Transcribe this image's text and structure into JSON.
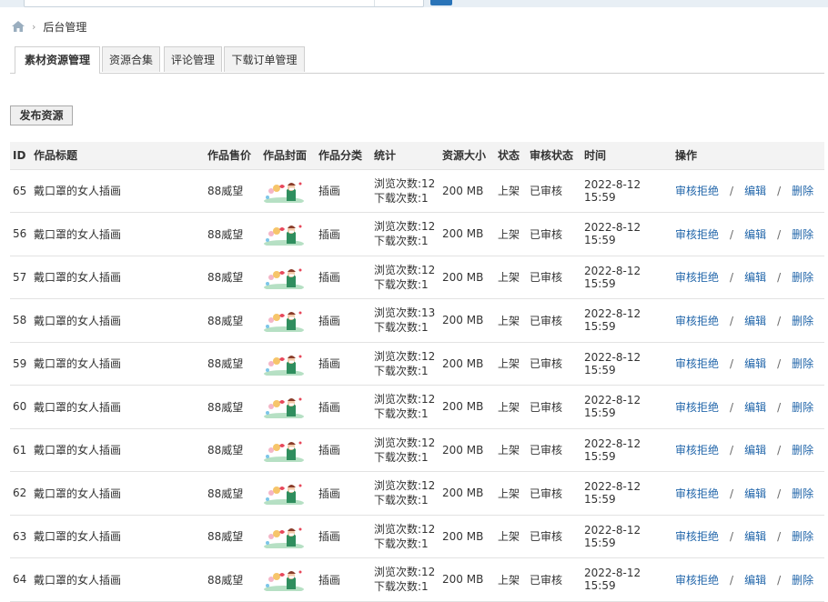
{
  "breadcrumb": {
    "home_icon": "home-icon",
    "separator": "›",
    "current": "后台管理"
  },
  "tabs": [
    {
      "label": "素材资源管理",
      "active": true
    },
    {
      "label": "资源合集",
      "active": false
    },
    {
      "label": "评论管理",
      "active": false
    },
    {
      "label": "下载订单管理",
      "active": false
    }
  ],
  "publish_button": "发布资源",
  "table": {
    "headers": {
      "id": "ID",
      "title": "作品标题",
      "price": "作品售价",
      "cover": "作品封面",
      "category": "作品分类",
      "stats": "统计",
      "size": "资源大小",
      "status": "状态",
      "review": "审核状态",
      "time": "时间",
      "actions": "操作"
    },
    "rows": [
      {
        "id": "65",
        "title": "戴口罩的女人插画",
        "price": "88威望",
        "category": "插画",
        "views": "浏览次数:12",
        "downloads": "下载次数:1",
        "size": "200 MB",
        "status": "上架",
        "review": "已审核",
        "time": "2022-8-12 15:59",
        "reject": "审核拒绝",
        "edit": "编辑",
        "delete": "删除"
      },
      {
        "id": "56",
        "title": "戴口罩的女人插画",
        "price": "88威望",
        "category": "插画",
        "views": "浏览次数:12",
        "downloads": "下载次数:1",
        "size": "200 MB",
        "status": "上架",
        "review": "已审核",
        "time": "2022-8-12 15:59",
        "reject": "审核拒绝",
        "edit": "编辑",
        "delete": "删除"
      },
      {
        "id": "57",
        "title": "戴口罩的女人插画",
        "price": "88威望",
        "category": "插画",
        "views": "浏览次数:12",
        "downloads": "下载次数:1",
        "size": "200 MB",
        "status": "上架",
        "review": "已审核",
        "time": "2022-8-12 15:59",
        "reject": "审核拒绝",
        "edit": "编辑",
        "delete": "删除"
      },
      {
        "id": "58",
        "title": "戴口罩的女人插画",
        "price": "88威望",
        "category": "插画",
        "views": "浏览次数:13",
        "downloads": "下载次数:1",
        "size": "200 MB",
        "status": "上架",
        "review": "已审核",
        "time": "2022-8-12 15:59",
        "reject": "审核拒绝",
        "edit": "编辑",
        "delete": "删除"
      },
      {
        "id": "59",
        "title": "戴口罩的女人插画",
        "price": "88威望",
        "category": "插画",
        "views": "浏览次数:12",
        "downloads": "下载次数:1",
        "size": "200 MB",
        "status": "上架",
        "review": "已审核",
        "time": "2022-8-12 15:59",
        "reject": "审核拒绝",
        "edit": "编辑",
        "delete": "删除"
      },
      {
        "id": "60",
        "title": "戴口罩的女人插画",
        "price": "88威望",
        "category": "插画",
        "views": "浏览次数:12",
        "downloads": "下载次数:1",
        "size": "200 MB",
        "status": "上架",
        "review": "已审核",
        "time": "2022-8-12 15:59",
        "reject": "审核拒绝",
        "edit": "编辑",
        "delete": "删除"
      },
      {
        "id": "61",
        "title": "戴口罩的女人插画",
        "price": "88威望",
        "category": "插画",
        "views": "浏览次数:12",
        "downloads": "下载次数:1",
        "size": "200 MB",
        "status": "上架",
        "review": "已审核",
        "time": "2022-8-12 15:59",
        "reject": "审核拒绝",
        "edit": "编辑",
        "delete": "删除"
      },
      {
        "id": "62",
        "title": "戴口罩的女人插画",
        "price": "88威望",
        "category": "插画",
        "views": "浏览次数:12",
        "downloads": "下载次数:1",
        "size": "200 MB",
        "status": "上架",
        "review": "已审核",
        "time": "2022-8-12 15:59",
        "reject": "审核拒绝",
        "edit": "编辑",
        "delete": "删除"
      },
      {
        "id": "63",
        "title": "戴口罩的女人插画",
        "price": "88威望",
        "category": "插画",
        "views": "浏览次数:12",
        "downloads": "下载次数:1",
        "size": "200 MB",
        "status": "上架",
        "review": "已审核",
        "time": "2022-8-12 15:59",
        "reject": "审核拒绝",
        "edit": "编辑",
        "delete": "删除"
      },
      {
        "id": "64",
        "title": "戴口罩的女人插画",
        "price": "88威望",
        "category": "插画",
        "views": "浏览次数:12",
        "downloads": "下载次数:1",
        "size": "200 MB",
        "status": "上架",
        "review": "已审核",
        "time": "2022-8-12 15:59",
        "reject": "审核拒绝",
        "edit": "编辑",
        "delete": "删除"
      }
    ]
  },
  "colors": {
    "link": "#2266aa",
    "header_bg": "#f3f3f3",
    "accent": "#2a74b8"
  }
}
